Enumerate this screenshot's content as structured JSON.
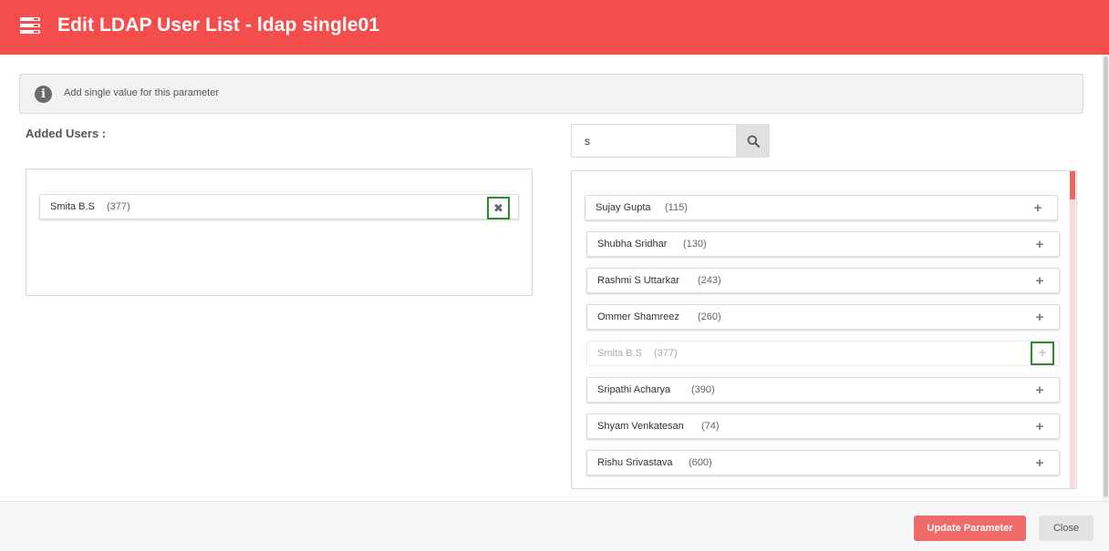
{
  "header": {
    "title": "Edit LDAP User List - ldap single01",
    "icon": "list-icon"
  },
  "info": {
    "text": "Add single value for this parameter",
    "icon": "info-icon"
  },
  "added": {
    "label": "Added Users :",
    "users": [
      {
        "name": "Smita B.S",
        "id": "(377)",
        "remove_icon": "close-icon"
      }
    ]
  },
  "search": {
    "value": "s",
    "icon": "search-icon"
  },
  "results": [
    {
      "name": "Sujay Gupta",
      "id": "(115)"
    },
    {
      "name": "Shubha Sridhar",
      "id": "(130)"
    },
    {
      "name": "Rashmi S Uttarkar",
      "id": "(243)"
    },
    {
      "name": "Ommer Shamreez",
      "id": "(260)"
    },
    {
      "name": "Smita B.S",
      "id": "(377)",
      "disabled": true
    },
    {
      "name": "Sripathi Acharya",
      "id": "(390)"
    },
    {
      "name": "Shyam Venkatesan",
      "id": "(74)"
    },
    {
      "name": "Rishu Srivastava",
      "id": "(600)"
    }
  ],
  "footer": {
    "update_label": "Update Parameter",
    "close_label": "Close"
  },
  "colors": {
    "header": "#f44e4c",
    "primary_button": "#f06a6a",
    "focus_outline": "#2e8b2e"
  }
}
